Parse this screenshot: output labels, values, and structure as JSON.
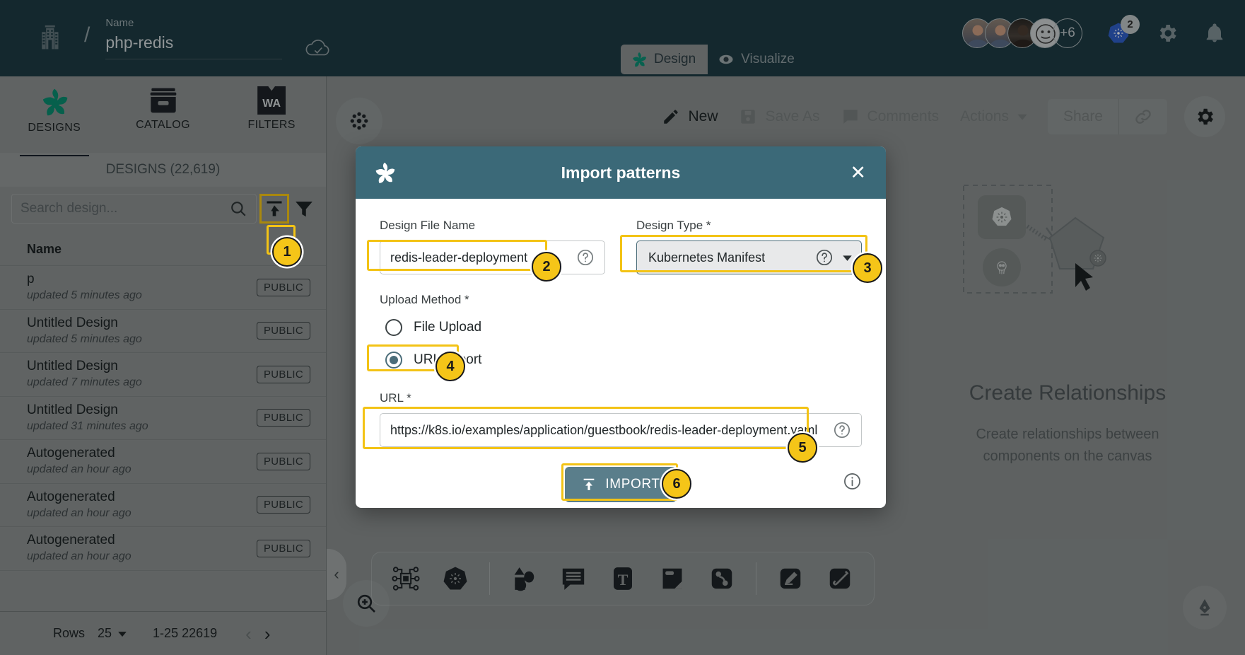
{
  "header": {
    "org_icon": "building-icon",
    "separator": "/",
    "name_label": "Name",
    "name_value": "php-redis",
    "cloud_icon": "cloud-check-icon",
    "tabs": [
      {
        "label": "Design",
        "icon": "meshery-logo-icon",
        "active": true
      },
      {
        "label": "Visualize",
        "icon": "eye-icon",
        "active": false
      }
    ],
    "avatars_overflow": "+6",
    "kubernetes_badge_count": "2",
    "settings_icon": "gear-icon",
    "notifications_icon": "bell-icon"
  },
  "left_panel": {
    "tabs": [
      {
        "label": "DESIGNS",
        "icon": "meshery-logo-icon",
        "active": true
      },
      {
        "label": "CATALOG",
        "icon": "catalog-box-icon",
        "active": false
      },
      {
        "label": "FILTERS",
        "icon": "wa-filter-icon",
        "active": false,
        "glyph": "WA"
      }
    ],
    "section_title": "DESIGNS (22,619)",
    "search": {
      "placeholder": "Search design...",
      "value": ""
    },
    "import_icon": "import-upload-icon",
    "filter_icon": "filter-funnel-icon",
    "column_header": "Name",
    "rows": [
      {
        "name": "p",
        "updated": "updated 5 minutes ago",
        "visibility": "PUBLIC"
      },
      {
        "name": "Untitled Design",
        "updated": "updated 5 minutes ago",
        "visibility": "PUBLIC"
      },
      {
        "name": "Untitled Design",
        "updated": "updated 7 minutes ago",
        "visibility": "PUBLIC"
      },
      {
        "name": "Untitled Design",
        "updated": "updated 31 minutes ago",
        "visibility": "PUBLIC"
      },
      {
        "name": "Autogenerated",
        "updated": "updated an hour ago",
        "visibility": "PUBLIC"
      },
      {
        "name": "Autogenerated",
        "updated": "updated an hour ago",
        "visibility": "PUBLIC"
      },
      {
        "name": "Autogenerated",
        "updated": "updated an hour ago",
        "visibility": "PUBLIC"
      }
    ],
    "footer": {
      "rows_label": "Rows",
      "rows_per_page": "25",
      "range": "1-25 22619",
      "prev_icon": "chevron-left-icon",
      "next_icon": "chevron-right-icon"
    },
    "collapse_icon": "chevron-left-icon"
  },
  "canvas_toolbar": {
    "items": [
      {
        "label": "New",
        "icon": "pencil-icon",
        "enabled": true
      },
      {
        "label": "Save As",
        "icon": "save-disk-icon",
        "enabled": false
      },
      {
        "label": "Comments",
        "icon": "comment-icon",
        "enabled": false
      },
      {
        "label": "Actions",
        "icon": "chevron-down-icon",
        "enabled": false
      }
    ],
    "share_label": "Share",
    "link_icon": "link-chain-icon",
    "settings_icon": "gear-icon",
    "canvas_settings_icon": "snowflake-node-icon"
  },
  "empty_state": {
    "title": "Create Relationships",
    "description": "Create relationships between components on the canvas"
  },
  "bottom_dock": {
    "buttons": [
      {
        "icon": "chip-node-icon"
      },
      {
        "icon": "kubernetes-icon"
      },
      {
        "icon": "shapes-icon"
      },
      {
        "icon": "comment-icon"
      },
      {
        "icon": "text-tool-icon"
      },
      {
        "icon": "note-card-icon"
      },
      {
        "icon": "connection-icon"
      },
      {
        "icon": "pen-edit-icon"
      },
      {
        "icon": "freehand-icon"
      }
    ],
    "zoom_icon": "zoom-in-icon",
    "pen_icon": "fountain-pen-icon"
  },
  "modal": {
    "title": "Import patterns",
    "logo_icon": "meshery-logo-icon",
    "close_icon": "close-x-icon",
    "design_file_name": {
      "label": "Design File Name",
      "value": "redis-leader-deployment",
      "help_icon": "question-circle-icon"
    },
    "design_type": {
      "label": "Design Type *",
      "value": "Kubernetes Manifest",
      "help_icon": "question-circle-icon",
      "caret_icon": "chevron-down-icon"
    },
    "upload_method": {
      "label": "Upload Method *",
      "options": [
        {
          "label": "File Upload",
          "selected": false
        },
        {
          "label": "URL Import",
          "selected": true
        }
      ]
    },
    "url": {
      "label": "URL *",
      "value": "https://k8s.io/examples/application/guestbook/redis-leader-deployment.yaml",
      "help_icon": "question-circle-icon"
    },
    "import_button": {
      "label": "IMPORT",
      "icon": "upload-icon"
    },
    "info_icon": "info-circle-icon"
  },
  "callouts": [
    {
      "number": "1"
    },
    {
      "number": "2"
    },
    {
      "number": "3"
    },
    {
      "number": "4"
    },
    {
      "number": "5"
    },
    {
      "number": "6"
    }
  ],
  "colors": {
    "header_bg": "#1e3a42",
    "modal_header_bg": "#3b6978",
    "accent_yellow": "#f3c315",
    "panel_bg": "#8a8f8f",
    "import_button": "#5a7e8b",
    "meshery_green": "#00897b"
  }
}
